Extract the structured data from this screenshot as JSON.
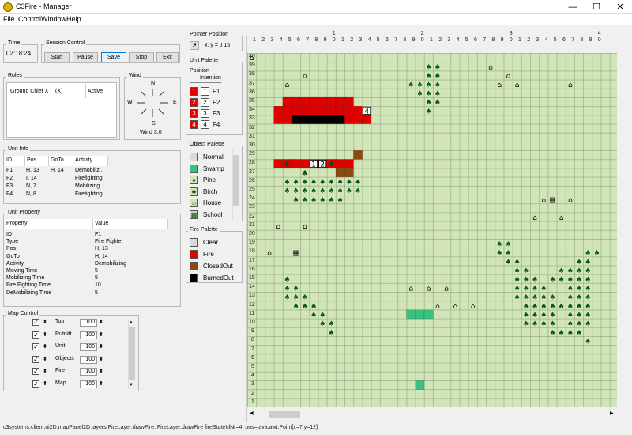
{
  "window": {
    "title": "C3Fire - Manager",
    "minimize": "—",
    "maximize": "☐",
    "close": "✕"
  },
  "menu": [
    "File",
    "Control",
    "Window",
    "Help"
  ],
  "time": {
    "title": "Time",
    "value": "02:18:24"
  },
  "session": {
    "title": "Session Control",
    "buttons": [
      "Start",
      "Pause",
      "Save",
      "Stop",
      "Exit"
    ]
  },
  "roles": {
    "title": "Roles",
    "name": "Ground Chief X",
    "x": "(X)",
    "status": "Active"
  },
  "wind": {
    "title": "Wind",
    "n": "N",
    "s": "S",
    "e": "E",
    "w": "W",
    "label": "Wind 3.0"
  },
  "pointer": {
    "title": "Pointer Position",
    "text": "x, y = J 15"
  },
  "unit_palette": {
    "title": "Unit Palette",
    "col1": "Position",
    "col2": "Intention",
    "units": [
      {
        "label": "F1",
        "num": "1"
      },
      {
        "label": "F2",
        "num": "2"
      },
      {
        "label": "F3",
        "num": "3"
      },
      {
        "label": "F4",
        "num": "4"
      }
    ]
  },
  "object_palette": {
    "title": "Object Palette",
    "items": [
      {
        "label": "Normal",
        "color": "#d9d9d9"
      },
      {
        "label": "Swamp",
        "color": "#3cc080"
      },
      {
        "label": "Pine",
        "color": "#d2e5b8"
      },
      {
        "label": "Birch",
        "color": "#d2e5b8"
      },
      {
        "label": "House",
        "color": "#d2e5b8"
      },
      {
        "label": "School",
        "color": "#d2e5b8"
      }
    ]
  },
  "fire_palette": {
    "title": "Fire Palette",
    "items": [
      {
        "label": "Clear",
        "color": "#d9d9d9"
      },
      {
        "label": "Fire",
        "color": "#e00000"
      },
      {
        "label": "ClosedOut",
        "color": "#8b4a10"
      },
      {
        "label": "BurnedOut",
        "color": "#000000"
      }
    ]
  },
  "unit_info": {
    "title": "Unit Info",
    "headers": [
      "ID",
      "Pos",
      "GoTo",
      "Activity"
    ],
    "rows": [
      [
        "F1",
        "H, 13",
        "H, 14",
        "Demobiliz..."
      ],
      [
        "F2",
        "I, 14",
        "",
        "Firefighting"
      ],
      [
        "F3",
        "N, 7",
        "",
        "Mobilizing"
      ],
      [
        "F4",
        "N, 8",
        "",
        "Firefighting"
      ]
    ]
  },
  "unit_property": {
    "title": "Unit Property",
    "headers": [
      "Property",
      "Value"
    ],
    "rows": [
      [
        "ID",
        "F1"
      ],
      [
        "Type",
        "Fire Fighter"
      ],
      [
        "Pos",
        "H, 13"
      ],
      [
        "GoTo",
        "H, 14"
      ],
      [
        "Activity",
        "Demobilizing"
      ],
      [
        "Moving Time",
        "5"
      ],
      [
        "Mobilizing Time",
        "5"
      ],
      [
        "Fire Fighting Time",
        "10"
      ],
      [
        "DeMobilizing Time",
        "5"
      ]
    ]
  },
  "map_control": {
    "title": "Map Control",
    "rows": [
      {
        "label": "Top",
        "value": "100"
      },
      {
        "label": "Rutnät",
        "value": "100"
      },
      {
        "label": "Unit",
        "value": "100"
      },
      {
        "label": "Objects",
        "value": "100"
      },
      {
        "label": "Fire",
        "value": "100"
      },
      {
        "label": "Map",
        "value": "100"
      }
    ]
  },
  "map": {
    "x_tens": [
      "1",
      "2",
      "3",
      "4"
    ],
    "x_units": [
      "1",
      "2",
      "3",
      "4",
      "5",
      "6",
      "7",
      "8",
      "9",
      "0",
      "1",
      "2",
      "3",
      "4",
      "5",
      "6",
      "7",
      "8",
      "9",
      "0",
      "1",
      "2",
      "3",
      "4",
      "5",
      "6",
      "7",
      "8",
      "9",
      "0",
      "1",
      "2",
      "3",
      "4",
      "5",
      "6",
      "7",
      "8",
      "9",
      "0"
    ],
    "y_labels": [
      "40",
      "39",
      "38",
      "37",
      "36",
      "35",
      "34",
      "33",
      "32",
      "31",
      "30",
      "29",
      "28",
      "27",
      "26",
      "25",
      "24",
      "23",
      "22",
      "21",
      "20",
      "19",
      "18",
      "17",
      "16",
      "15",
      "14",
      "13",
      "12",
      "11",
      "10",
      "9",
      "8",
      "7",
      "6",
      "5",
      "4",
      "3",
      "2",
      "1"
    ]
  },
  "status": "c3systems.client.ui2D.mapPanel2D.layers.FireLayer.drawFire: FireLayer.drawFire fireStateIdNr=4, pos=java.awt.Point[x=7,y=12]"
}
